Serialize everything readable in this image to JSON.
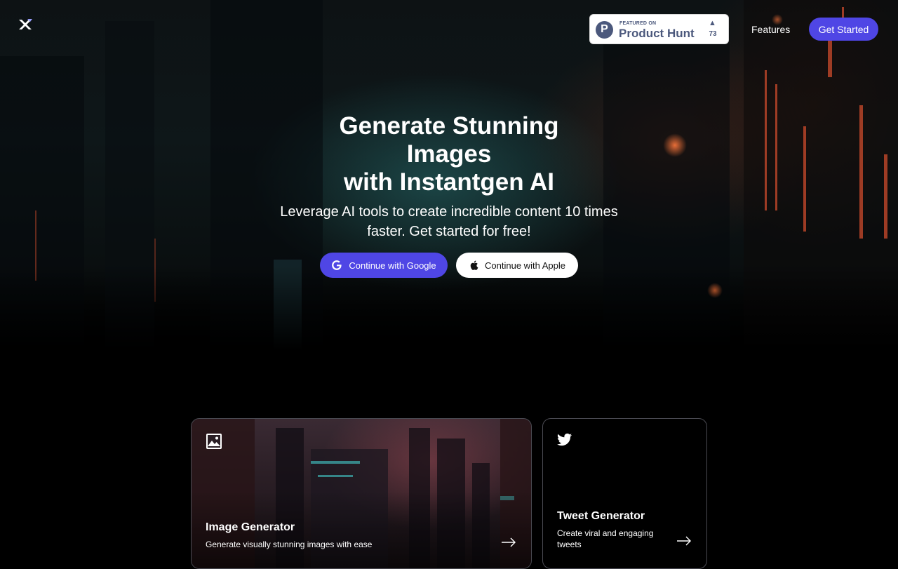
{
  "header": {
    "logo_icon": "instantgen-logo-icon",
    "product_hunt": {
      "small_label": "FEATURED ON",
      "big_label": "Product Hunt",
      "logo_letter": "P",
      "upvote_icon": "triangle-up-icon",
      "upvote_glyph": "▲",
      "count": "73"
    },
    "nav_features": "Features",
    "get_started": "Get Started"
  },
  "hero": {
    "title_lines": [
      "Generate Stunning",
      "Images",
      "with Instantgen AI"
    ],
    "subtitle": "Leverage AI tools to create incredible content 10 times faster. Get started for free!",
    "google_button": "Continue with Google",
    "apple_button": "Continue with Apple"
  },
  "cards": [
    {
      "icon": "image-icon",
      "title": "Image Generator",
      "description": "Generate visually stunning images with ease",
      "arrow_icon": "arrow-right-icon"
    },
    {
      "icon": "twitter-icon",
      "title": "Tweet Generator",
      "description": "Create viral and engaging tweets",
      "arrow_icon": "arrow-right-icon"
    }
  ],
  "colors": {
    "accent": "#4f46e5",
    "background": "#000000",
    "product_hunt_text": "#4b587c"
  }
}
